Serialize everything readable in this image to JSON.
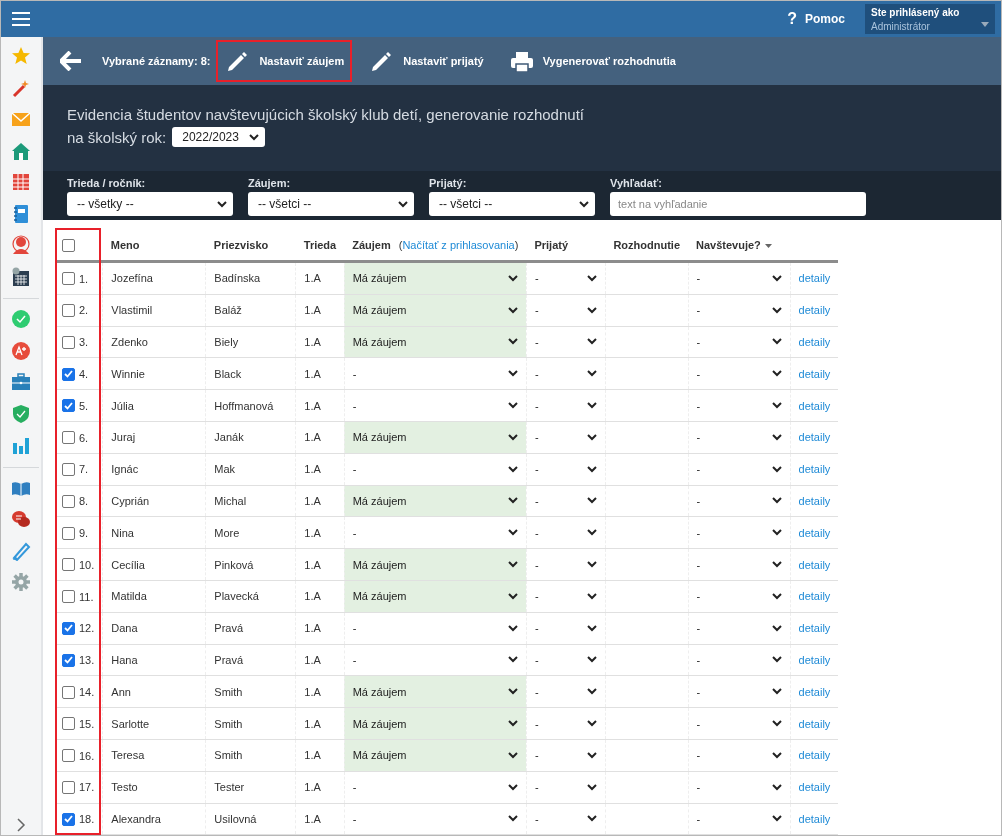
{
  "top_bar": {
    "help": {
      "icon_text": "?",
      "label": "Pomoc"
    },
    "user": {
      "caption": "Ste prihlásený ako",
      "name": "Administrátor"
    }
  },
  "toolbar": {
    "selected_count": "Vybrané záznamy: 8:",
    "actions": [
      {
        "kind": "pencil",
        "label": "Nastaviť záujem",
        "highlighted": true
      },
      {
        "kind": "pencil",
        "label": "Nastaviť prijatý",
        "highlighted": false
      },
      {
        "kind": "printer",
        "label": "Vygenerovať rozhodnutia",
        "highlighted": false
      }
    ]
  },
  "header": {
    "subtitle": "Evidencia študentov navštevujúcich školský klub detí, generovanie rozhodnutí",
    "year_label": "na školský rok:",
    "year": "2022/2023"
  },
  "filters": [
    {
      "kind": "select",
      "label": "Trieda / ročník:",
      "value": "-- všetky --"
    },
    {
      "kind": "select",
      "label": "Záujem:",
      "value": "-- všetci --"
    },
    {
      "kind": "select",
      "label": "Prijatý:",
      "value": "-- všetci --"
    },
    {
      "kind": "search",
      "label": "Vyhľadať:",
      "placeholder": "text na vyhľadanie"
    }
  ],
  "table": {
    "select_all_checked": false,
    "checkbox_column_highlighted": true,
    "columns": {
      "first_name": "Meno",
      "last_name": "Priezvisko",
      "class": "Trieda",
      "interest": "Záujem",
      "interest_link_open": "(",
      "interest_link": "Načítať z prihlasovania",
      "interest_link_close": ")",
      "accepted": "Prijatý",
      "decision": "Rozhodnutie",
      "attends": "Navštevuje?"
    },
    "rows": [
      {
        "number": "1.",
        "checked": false,
        "first_name": "Jozefína",
        "last_name": "Badínska",
        "class": "1.A",
        "interest": "Má záujem",
        "interested": true,
        "accepted": "-",
        "attends": "-",
        "link": "detaily"
      },
      {
        "number": "2.",
        "checked": false,
        "first_name": "Vlastimil",
        "last_name": "Baláž",
        "class": "1.A",
        "interest": "Má záujem",
        "interested": true,
        "accepted": "-",
        "attends": "-",
        "link": "detaily"
      },
      {
        "number": "3.",
        "checked": false,
        "first_name": "Zdenko",
        "last_name": "Biely",
        "class": "1.A",
        "interest": "Má záujem",
        "interested": true,
        "accepted": "-",
        "attends": "-",
        "link": "detaily"
      },
      {
        "number": "4.",
        "checked": true,
        "first_name": "Winnie",
        "last_name": "Black",
        "class": "1.A",
        "interest": "-",
        "interested": false,
        "accepted": "-",
        "attends": "-",
        "link": "detaily"
      },
      {
        "number": "5.",
        "checked": true,
        "first_name": "Júlia",
        "last_name": "Hoffmanová",
        "class": "1.A",
        "interest": "-",
        "interested": false,
        "accepted": "-",
        "attends": "-",
        "link": "detaily"
      },
      {
        "number": "6.",
        "checked": false,
        "first_name": "Juraj",
        "last_name": "Janák",
        "class": "1.A",
        "interest": "Má záujem",
        "interested": true,
        "accepted": "-",
        "attends": "-",
        "link": "detaily"
      },
      {
        "number": "7.",
        "checked": false,
        "first_name": "Ignác",
        "last_name": "Mak",
        "class": "1.A",
        "interest": "-",
        "interested": false,
        "accepted": "-",
        "attends": "-",
        "link": "detaily"
      },
      {
        "number": "8.",
        "checked": false,
        "first_name": "Cyprián",
        "last_name": "Michal",
        "class": "1.A",
        "interest": "Má záujem",
        "interested": true,
        "accepted": "-",
        "attends": "-",
        "link": "detaily"
      },
      {
        "number": "9.",
        "checked": false,
        "first_name": "Nina",
        "last_name": "More",
        "class": "1.A",
        "interest": "-",
        "interested": false,
        "accepted": "-",
        "attends": "-",
        "link": "detaily"
      },
      {
        "number": "10.",
        "checked": false,
        "first_name": "Cecília",
        "last_name": "Pinková",
        "class": "1.A",
        "interest": "Má záujem",
        "interested": true,
        "accepted": "-",
        "attends": "-",
        "link": "detaily"
      },
      {
        "number": "11.",
        "checked": false,
        "first_name": "Matilda",
        "last_name": "Plavecká",
        "class": "1.A",
        "interest": "Má záujem",
        "interested": true,
        "accepted": "-",
        "attends": "-",
        "link": "detaily"
      },
      {
        "number": "12.",
        "checked": true,
        "first_name": "Dana",
        "last_name": "Pravá",
        "class": "1.A",
        "interest": "-",
        "interested": false,
        "accepted": "-",
        "attends": "-",
        "link": "detaily"
      },
      {
        "number": "13.",
        "checked": true,
        "first_name": "Hana",
        "last_name": "Pravá",
        "class": "1.A",
        "interest": "-",
        "interested": false,
        "accepted": "-",
        "attends": "-",
        "link": "detaily"
      },
      {
        "number": "14.",
        "checked": false,
        "first_name": "Ann",
        "last_name": "Smith",
        "class": "1.A",
        "interest": "Má záujem",
        "interested": true,
        "accepted": "-",
        "attends": "-",
        "link": "detaily"
      },
      {
        "number": "15.",
        "checked": false,
        "first_name": "Sarlotte",
        "last_name": "Smith",
        "class": "1.A",
        "interest": "Má záujem",
        "interested": true,
        "accepted": "-",
        "attends": "-",
        "link": "detaily"
      },
      {
        "number": "16.",
        "checked": false,
        "first_name": "Teresa",
        "last_name": "Smith",
        "class": "1.A",
        "interest": "Má záujem",
        "interested": true,
        "accepted": "-",
        "attends": "-",
        "link": "detaily"
      },
      {
        "number": "17.",
        "checked": false,
        "first_name": "Testo",
        "last_name": "Tester",
        "class": "1.A",
        "interest": "-",
        "interested": false,
        "accepted": "-",
        "attends": "-",
        "link": "detaily"
      },
      {
        "number": "18.",
        "checked": true,
        "first_name": "Alexandra",
        "last_name": "Usilovná",
        "class": "1.A",
        "interest": "-",
        "interested": false,
        "accepted": "-",
        "attends": "-",
        "link": "detaily"
      }
    ]
  }
}
